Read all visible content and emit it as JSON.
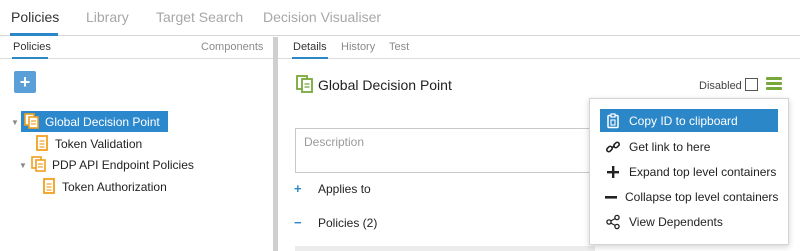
{
  "topnav": {
    "tabs": [
      {
        "label": "Policies",
        "active": true
      },
      {
        "label": "Library",
        "active": false
      },
      {
        "label": "Target Search",
        "active": false
      },
      {
        "label": "Decision Visualiser",
        "active": false
      }
    ]
  },
  "left": {
    "subtabs": [
      {
        "label": "Policies",
        "active": true
      },
      {
        "label": "Components",
        "active": false
      }
    ],
    "add_button_label": "+",
    "tree": [
      {
        "label": "Global Decision Point",
        "selected": true,
        "icon": "policy-set-icon"
      },
      {
        "label": "Token Validation",
        "selected": false,
        "icon": "policy-icon"
      },
      {
        "label": "PDP API Endpoint Policies",
        "selected": false,
        "icon": "policy-set-icon"
      },
      {
        "label": "Token Authorization",
        "selected": false,
        "icon": "policy-icon"
      }
    ]
  },
  "right": {
    "subtabs": [
      {
        "label": "Details",
        "active": true
      },
      {
        "label": "History",
        "active": false
      },
      {
        "label": "Test",
        "active": false
      }
    ],
    "title": "Global Decision Point",
    "disabled_label": "Disabled",
    "disabled_checked": false,
    "description_placeholder": "Description",
    "sections": [
      {
        "sign": "+",
        "label": "Applies to"
      },
      {
        "sign": "−",
        "label": "Policies (2)"
      }
    ]
  },
  "menu": {
    "items": [
      {
        "label": "Copy ID to clipboard",
        "icon": "clipboard-icon",
        "active": true
      },
      {
        "label": "Get link to here",
        "icon": "link-icon",
        "active": false
      },
      {
        "label": "Expand top level containers",
        "icon": "plus-icon",
        "active": false
      },
      {
        "label": "Collapse top level containers",
        "icon": "minus-icon",
        "active": false
      },
      {
        "label": "View Dependents",
        "icon": "share-icon",
        "active": false
      }
    ]
  },
  "colors": {
    "accent": "#2b87c8",
    "icon_orange": "#f0a020",
    "icon_green": "#79a83a"
  }
}
